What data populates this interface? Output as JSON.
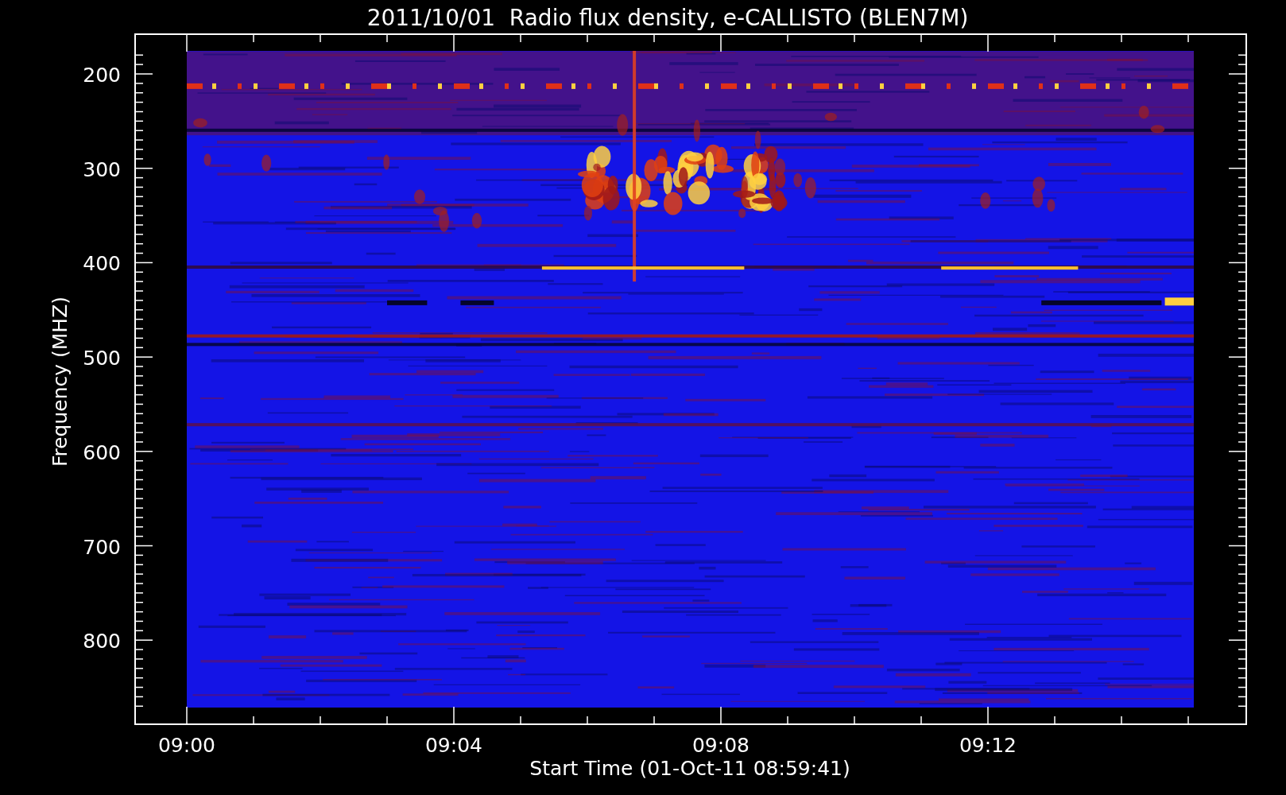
{
  "chart": {
    "title": "2011/10/01  Radio flux density, e-CALLISTO (BLEN7M)",
    "ylabel": "Frequency (MHZ)",
    "xlabel": "Start Time (01-Oct-11 08:59:41)",
    "yticks": [
      "200",
      "300",
      "400",
      "500",
      "600",
      "700",
      "800"
    ],
    "xticks": [
      "09:00",
      "09:04",
      "09:08",
      "09:12"
    ]
  }
}
